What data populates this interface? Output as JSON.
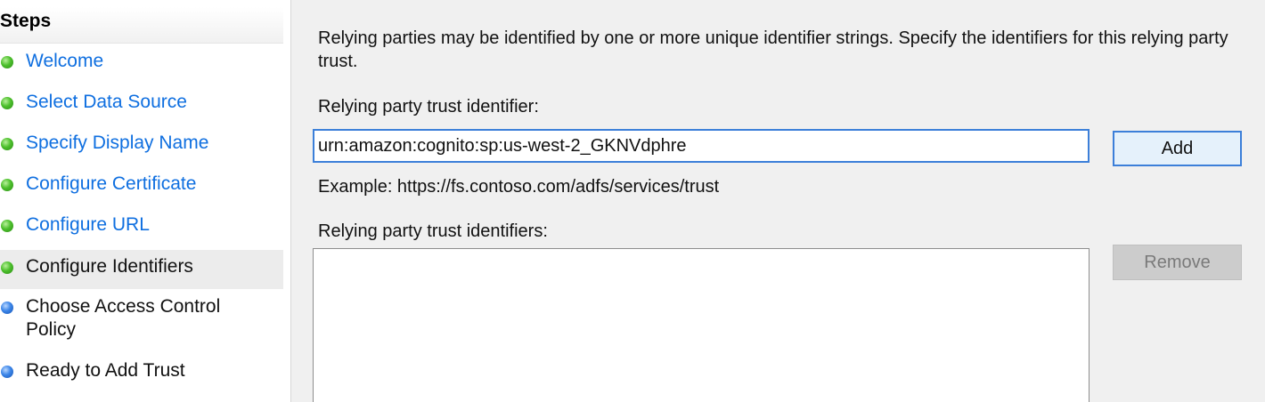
{
  "steps": {
    "title": "Steps",
    "items": [
      {
        "label": "Welcome",
        "status": "done"
      },
      {
        "label": "Select Data Source",
        "status": "done"
      },
      {
        "label": "Specify Display Name",
        "status": "done"
      },
      {
        "label": "Configure Certificate",
        "status": "done"
      },
      {
        "label": "Configure URL",
        "status": "done"
      },
      {
        "label": "Configure Identifiers",
        "status": "current"
      },
      {
        "label": "Choose Access Control Policy",
        "status": "pending"
      },
      {
        "label": "Ready to Add Trust",
        "status": "pending"
      }
    ]
  },
  "content": {
    "intro": "Relying parties may be identified by one or more unique identifier strings. Specify the identifiers for this relying party trust.",
    "identifier_label": "Relying party trust identifier:",
    "identifier_value": "urn:amazon:cognito:sp:us-west-2_GKNVdphre",
    "add_button": "Add",
    "example": "Example: https://fs.contoso.com/adfs/services/trust",
    "identifiers_label": "Relying party trust identifiers:",
    "remove_button": "Remove",
    "identifiers": []
  },
  "colors": {
    "link": "#0f6fe0",
    "done_dot": "#3fae22",
    "pending_dot": "#2f75d8",
    "focus_border": "#3c7fd9",
    "pane_bg": "#f0f0f0"
  },
  "icons": {
    "done": "green-status-dot-icon",
    "pending": "blue-status-dot-icon"
  }
}
